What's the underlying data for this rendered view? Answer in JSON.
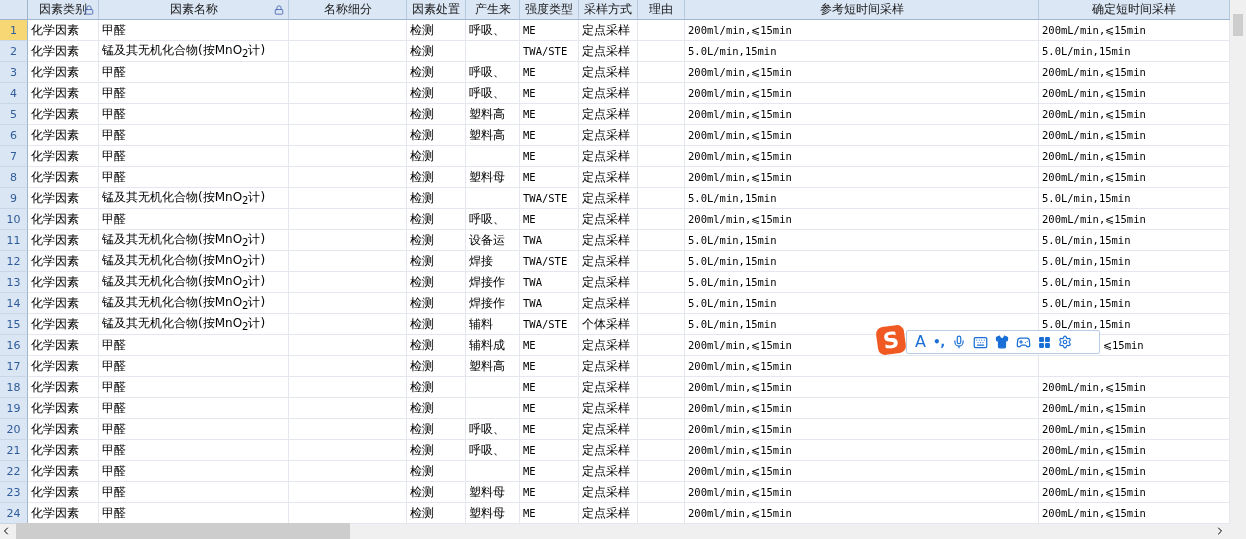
{
  "columns": [
    {
      "label": "因素类别",
      "locked": true
    },
    {
      "label": "因素名称",
      "locked": true
    },
    {
      "label": "名称细分",
      "locked": false
    },
    {
      "label": "因素处置",
      "locked": false
    },
    {
      "label": "产生来",
      "locked": false
    },
    {
      "label": "强度类型",
      "locked": false
    },
    {
      "label": "采样方式",
      "locked": false
    },
    {
      "label": "理由",
      "locked": false
    },
    {
      "label": "参考短时间采样",
      "locked": false
    },
    {
      "label": "确定短时间采样",
      "locked": false
    }
  ],
  "rows": [
    {
      "num": "1",
      "selected": true,
      "category": "化学因素",
      "name": "甲醛",
      "disposal": "检测",
      "source": "呼吸、",
      "intensity": "ME",
      "method": "定点采样",
      "reference": "200ml/min,⩽15min",
      "confirmed": "200mL/min,⩽15min"
    },
    {
      "num": "2",
      "selected": false,
      "category": "化学因素",
      "name": "锰及其无机化合物(按MnO$_{2}$计)",
      "disposal": "检测",
      "intensity": "TWA/STE",
      "method": "定点采样",
      "reference": "5.0L/min,15min",
      "confirmed": "5.0L/min,15min"
    },
    {
      "num": "3",
      "selected": false,
      "category": "化学因素",
      "name": "甲醛",
      "disposal": "检测",
      "source": "呼吸、",
      "intensity": "ME",
      "method": "定点采样",
      "reference": "200ml/min,⩽15min",
      "confirmed": "200mL/min,⩽15min"
    },
    {
      "num": "4",
      "selected": false,
      "category": "化学因素",
      "name": "甲醛",
      "disposal": "检测",
      "source": "呼吸、",
      "intensity": "ME",
      "method": "定点采样",
      "reference": "200ml/min,⩽15min",
      "confirmed": "200mL/min,⩽15min"
    },
    {
      "num": "5",
      "selected": false,
      "category": "化学因素",
      "name": "甲醛",
      "disposal": "检测",
      "source": "塑料高",
      "intensity": "ME",
      "method": "定点采样",
      "reference": "200ml/min,⩽15min",
      "confirmed": "200mL/min,⩽15min"
    },
    {
      "num": "6",
      "selected": false,
      "category": "化学因素",
      "name": "甲醛",
      "disposal": "检测",
      "source": "塑料高",
      "intensity": "ME",
      "method": "定点采样",
      "reference": "200ml/min,⩽15min",
      "confirmed": "200mL/min,⩽15min"
    },
    {
      "num": "7",
      "selected": false,
      "category": "化学因素",
      "name": "甲醛",
      "disposal": "检测",
      "intensity": "ME",
      "method": "定点采样",
      "reference": "200ml/min,⩽15min",
      "confirmed": "200mL/min,⩽15min"
    },
    {
      "num": "8",
      "selected": false,
      "category": "化学因素",
      "name": "甲醛",
      "disposal": "检测",
      "source": "塑料母",
      "intensity": "ME",
      "method": "定点采样",
      "reference": "200ml/min,⩽15min",
      "confirmed": "200mL/min,⩽15min"
    },
    {
      "num": "9",
      "selected": false,
      "category": "化学因素",
      "name": "锰及其无机化合物(按MnO$_{2}$计)",
      "disposal": "检测",
      "intensity": "TWA/STE",
      "method": "定点采样",
      "reference": "5.0L/min,15min",
      "confirmed": "5.0L/min,15min"
    },
    {
      "num": "10",
      "selected": false,
      "category": "化学因素",
      "name": "甲醛",
      "disposal": "检测",
      "source": "呼吸、",
      "intensity": "ME",
      "method": "定点采样",
      "reference": "200ml/min,⩽15min",
      "confirmed": "200mL/min,⩽15min"
    },
    {
      "num": "11",
      "selected": false,
      "category": "化学因素",
      "name": "锰及其无机化合物(按MnO$_{2}$计)",
      "disposal": "检测",
      "source": "设备运",
      "intensity": "TWA",
      "method": "定点采样",
      "reference": "5.0L/min,15min",
      "confirmed": "5.0L/min,15min"
    },
    {
      "num": "12",
      "selected": false,
      "category": "化学因素",
      "name": "锰及其无机化合物(按MnO$_{2}$计)",
      "disposal": "检测",
      "source": "焊接",
      "intensity": "TWA/STE",
      "method": "定点采样",
      "reference": "5.0L/min,15min",
      "confirmed": "5.0L/min,15min"
    },
    {
      "num": "13",
      "selected": false,
      "category": "化学因素",
      "name": "锰及其无机化合物(按MnO$_{2}$计)",
      "disposal": "检测",
      "source": "焊接作",
      "intensity": "TWA",
      "method": "定点采样",
      "reference": "5.0L/min,15min",
      "confirmed": "5.0L/min,15min"
    },
    {
      "num": "14",
      "selected": false,
      "category": "化学因素",
      "name": "锰及其无机化合物(按MnO$_{2}$计)",
      "disposal": "检测",
      "source": "焊接作",
      "intensity": "TWA",
      "method": "定点采样",
      "reference": "5.0L/min,15min",
      "confirmed": "5.0L/min,15min"
    },
    {
      "num": "15",
      "selected": false,
      "category": "化学因素",
      "name": "锰及其无机化合物(按MnO$_{2}$计)",
      "disposal": "检测",
      "source": "辅料",
      "intensity": "TWA/STE",
      "method": "个体采样",
      "reference": "5.0L/min,15min",
      "confirmed": "5.0L/min,15min"
    },
    {
      "num": "16",
      "selected": false,
      "category": "化学因素",
      "name": "甲醛",
      "disposal": "检测",
      "source": "辅料成",
      "intensity": "ME",
      "method": "定点采样",
      "reference": "200ml/min,⩽15min",
      "confirmed": "⩽15min",
      "confirmed_under_overlay": true
    },
    {
      "num": "17",
      "selected": false,
      "category": "化学因素",
      "name": "甲醛",
      "disposal": "检测",
      "source": "塑料高",
      "intensity": "ME",
      "method": "定点采样",
      "reference": "200ml/min,⩽15min"
    },
    {
      "num": "18",
      "selected": false,
      "category": "化学因素",
      "name": "甲醛",
      "disposal": "检测",
      "intensity": "ME",
      "method": "定点采样",
      "reference": "200ml/min,⩽15min",
      "confirmed": "200mL/min,⩽15min"
    },
    {
      "num": "19",
      "selected": false,
      "category": "化学因素",
      "name": "甲醛",
      "disposal": "检测",
      "intensity": "ME",
      "method": "定点采样",
      "reference": "200ml/min,⩽15min",
      "confirmed": "200mL/min,⩽15min"
    },
    {
      "num": "20",
      "selected": false,
      "category": "化学因素",
      "name": "甲醛",
      "disposal": "检测",
      "source": "呼吸、",
      "intensity": "ME",
      "method": "定点采样",
      "reference": "200ml/min,⩽15min",
      "confirmed": "200mL/min,⩽15min"
    },
    {
      "num": "21",
      "selected": false,
      "category": "化学因素",
      "name": "甲醛",
      "disposal": "检测",
      "source": "呼吸、",
      "intensity": "ME",
      "method": "定点采样",
      "reference": "200ml/min,⩽15min",
      "confirmed": "200mL/min,⩽15min"
    },
    {
      "num": "22",
      "selected": false,
      "category": "化学因素",
      "name": "甲醛",
      "disposal": "检测",
      "intensity": "ME",
      "method": "定点采样",
      "reference": "200ml/min,⩽15min",
      "confirmed": "200mL/min,⩽15min"
    },
    {
      "num": "23",
      "selected": false,
      "category": "化学因素",
      "name": "甲醛",
      "disposal": "检测",
      "source": "塑料母",
      "intensity": "ME",
      "method": "定点采样",
      "reference": "200ml/min,⩽15min",
      "confirmed": "200mL/min,⩽15min"
    },
    {
      "num": "24",
      "selected": false,
      "category": "化学因素",
      "name": "甲醛",
      "disposal": "检测",
      "source": "塑料母",
      "intensity": "ME",
      "method": "定点采样",
      "reference": "200ml/min,⩽15min",
      "confirmed": "200mL/min,⩽15min"
    }
  ],
  "ime_toolbar": {
    "logo": "S",
    "letter": "A",
    "punctuation": "•,"
  }
}
